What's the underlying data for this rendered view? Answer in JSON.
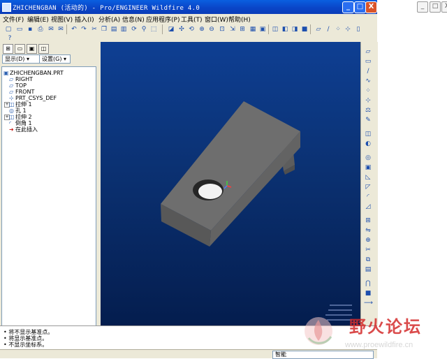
{
  "window": {
    "title": "ZHICHENGBAN (活动的) - Pro/ENGINEER Wildfire 4.0",
    "minimize": "_",
    "maximize": "□",
    "close": "X"
  },
  "desktop": {
    "minimize": "_",
    "maximize": "□",
    "close": "X"
  },
  "menu": [
    "文件(F)",
    "编辑(E)",
    "视图(V)",
    "插入(I)",
    "分析(A)",
    "信息(N)",
    "应用程序(P)",
    "工具(T)",
    "窗口(W)",
    "帮助(H)"
  ],
  "navigator": {
    "show_dropdown": "显示(D) ▾",
    "settings_dropdown": "设置(G) ▾"
  },
  "model_tree": [
    {
      "icon": "part-icon",
      "label": "ZHICHENGBAN.PRT"
    },
    {
      "icon": "datum-plane-icon",
      "label": "RIGHT"
    },
    {
      "icon": "datum-plane-icon",
      "label": "TOP"
    },
    {
      "icon": "datum-plane-icon",
      "label": "FRONT"
    },
    {
      "icon": "csys-icon",
      "label": "PRT_CSYS_DEF"
    },
    {
      "icon": "extrude-icon",
      "label": "拉伸 1"
    },
    {
      "icon": "hole-icon",
      "label": "孔 1"
    },
    {
      "icon": "extrude-icon",
      "label": "拉伸 2"
    },
    {
      "icon": "round-icon",
      "label": "倒角 1"
    },
    {
      "icon": "insert-here-icon",
      "label": "在此插入"
    }
  ],
  "messages": [
    "• 将不显示基准点。",
    "• 将显示基准点。",
    "• 不显示坐标系。"
  ],
  "status": {
    "filter": "智能"
  },
  "viewport": {
    "background_top": "#0e3f93",
    "background_bottom": "#041d4e",
    "part_color": "#6b6b6b"
  },
  "watermark": {
    "text": "野火论坛",
    "url": "www.proewildfire.cn",
    "color": "#d42c2c"
  }
}
